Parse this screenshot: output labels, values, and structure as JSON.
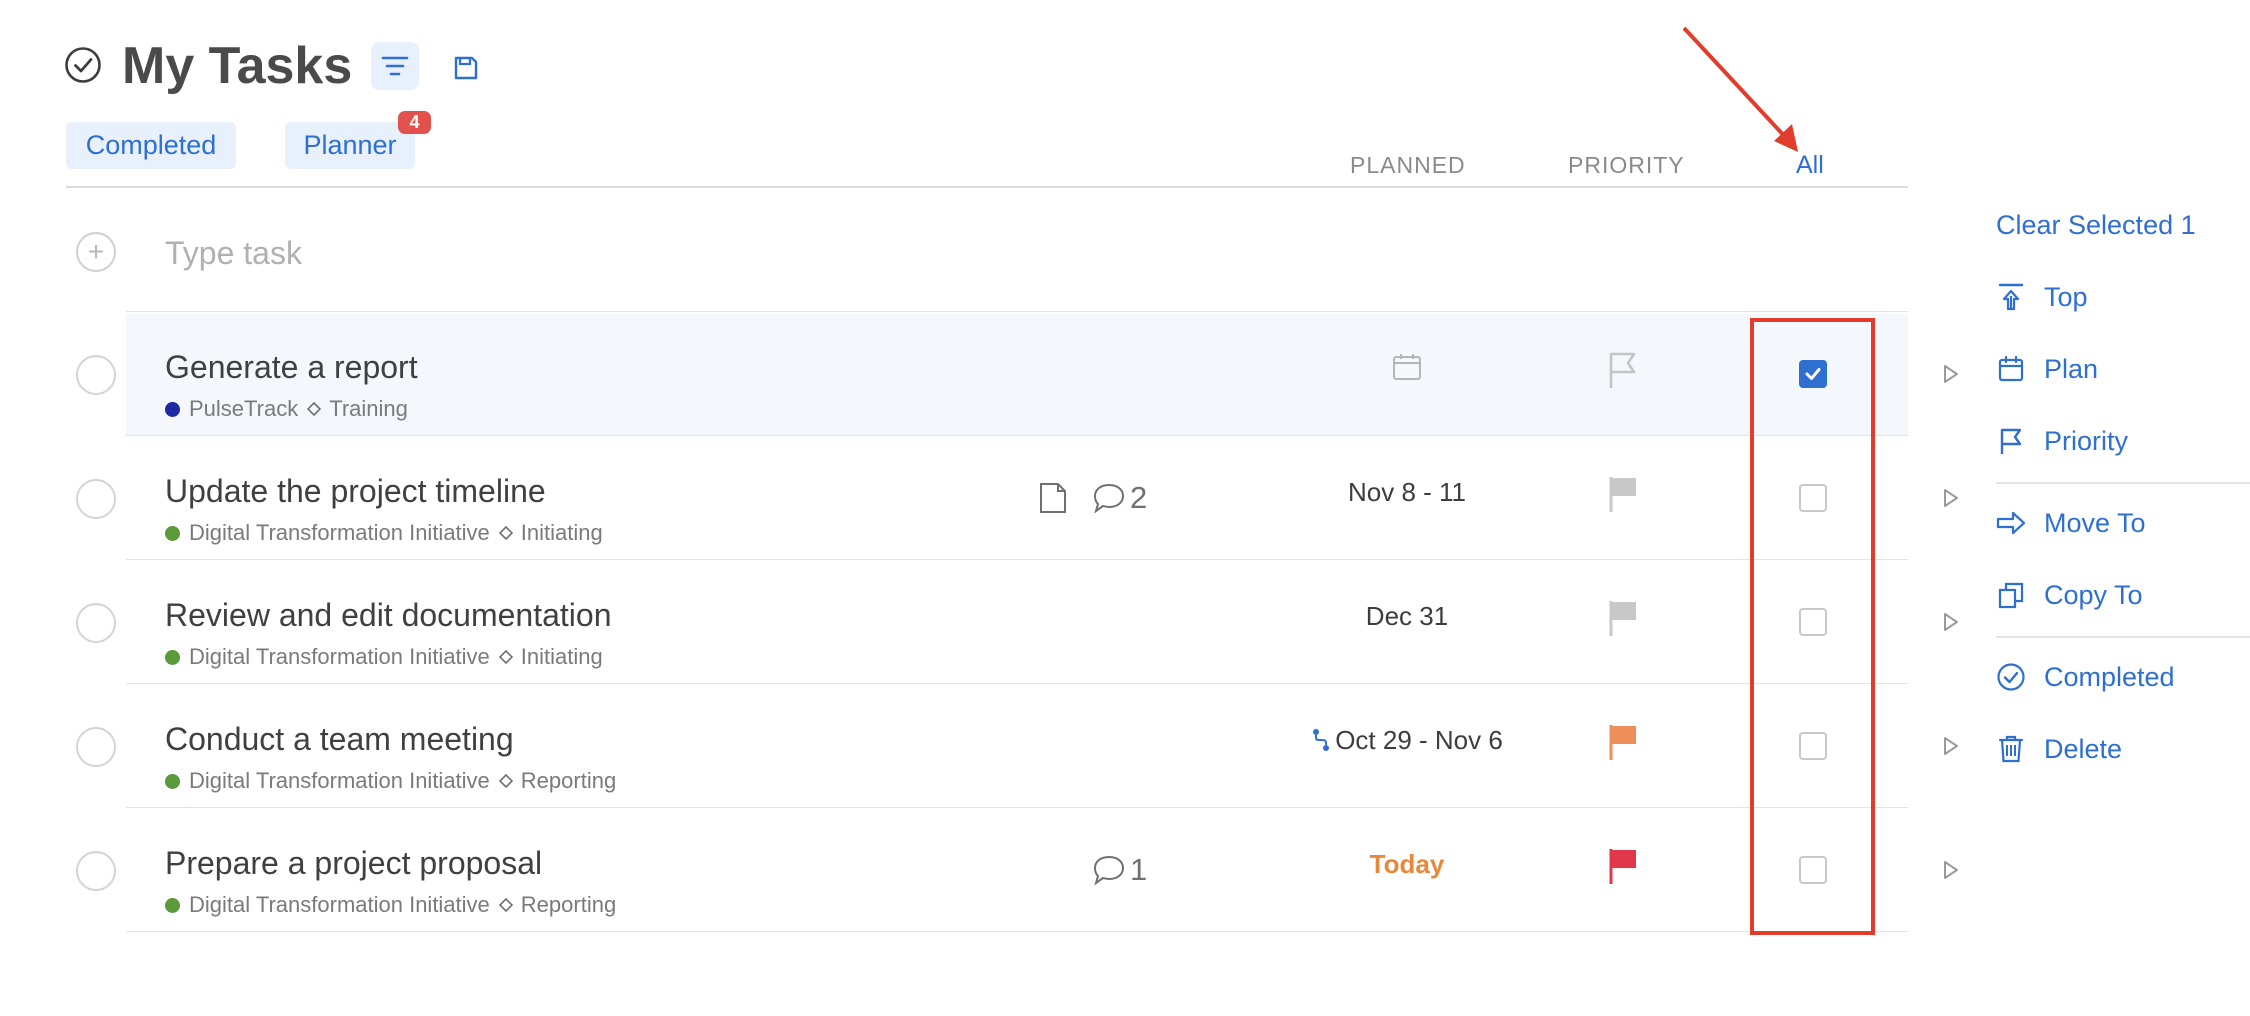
{
  "header": {
    "title": "My Tasks",
    "title_icon": "check-circle-icon",
    "filter_icon": "filter-icon",
    "save_icon": "save-icon"
  },
  "tabs": [
    {
      "label": "Completed"
    },
    {
      "label": "Planner",
      "badge": "4"
    }
  ],
  "columns": {
    "planned": "PLANNED",
    "priority": "PRIORITY",
    "all": "All"
  },
  "new_task": {
    "placeholder": "Type task"
  },
  "tasks": [
    {
      "title": "Generate a report",
      "project": "PulseTrack",
      "project_color": "#1f2aa3",
      "stage": "Training",
      "planned": "",
      "planned_icon": "calendar-icon",
      "priority_color": "#c4c4c4",
      "priority_outline": true,
      "selected": true
    },
    {
      "title": "Update the project timeline",
      "project": "Digital Transformation Initiative",
      "project_color": "#5a9a3a",
      "stage": "Initiating",
      "comments": "2",
      "has_note": true,
      "planned": "Nov 8 - 11",
      "priority_color": "#c8c8c8",
      "selected": false
    },
    {
      "title": "Review and edit documentation",
      "project": "Digital Transformation Initiative",
      "project_color": "#5a9a3a",
      "stage": "Initiating",
      "planned": "Dec 31",
      "priority_color": "#c8c8c8",
      "selected": false
    },
    {
      "title": "Conduct a team meeting",
      "project": "Digital Transformation Initiative",
      "project_color": "#5a9a3a",
      "stage": "Reporting",
      "planned": "Oct 29 - Nov 6",
      "planned_icon": "recurring-icon",
      "priority_color": "#ee8f5a",
      "selected": false
    },
    {
      "title": "Prepare a project proposal",
      "project": "Digital Transformation Initiative",
      "project_color": "#5a9a3a",
      "stage": "Reporting",
      "comments": "1",
      "planned": "Today",
      "planned_today": true,
      "priority_color": "#e0384a",
      "selected": false
    }
  ],
  "actions": {
    "clear_selected": "Clear Selected 1",
    "top": "Top",
    "plan": "Plan",
    "priority": "Priority",
    "move_to": "Move To",
    "copy_to": "Copy To",
    "completed": "Completed",
    "delete": "Delete"
  },
  "colors": {
    "accent": "#2f6fd0",
    "annotation_red": "#e23d2c",
    "badge_red": "#e0524b",
    "today_orange": "#e8893a"
  }
}
